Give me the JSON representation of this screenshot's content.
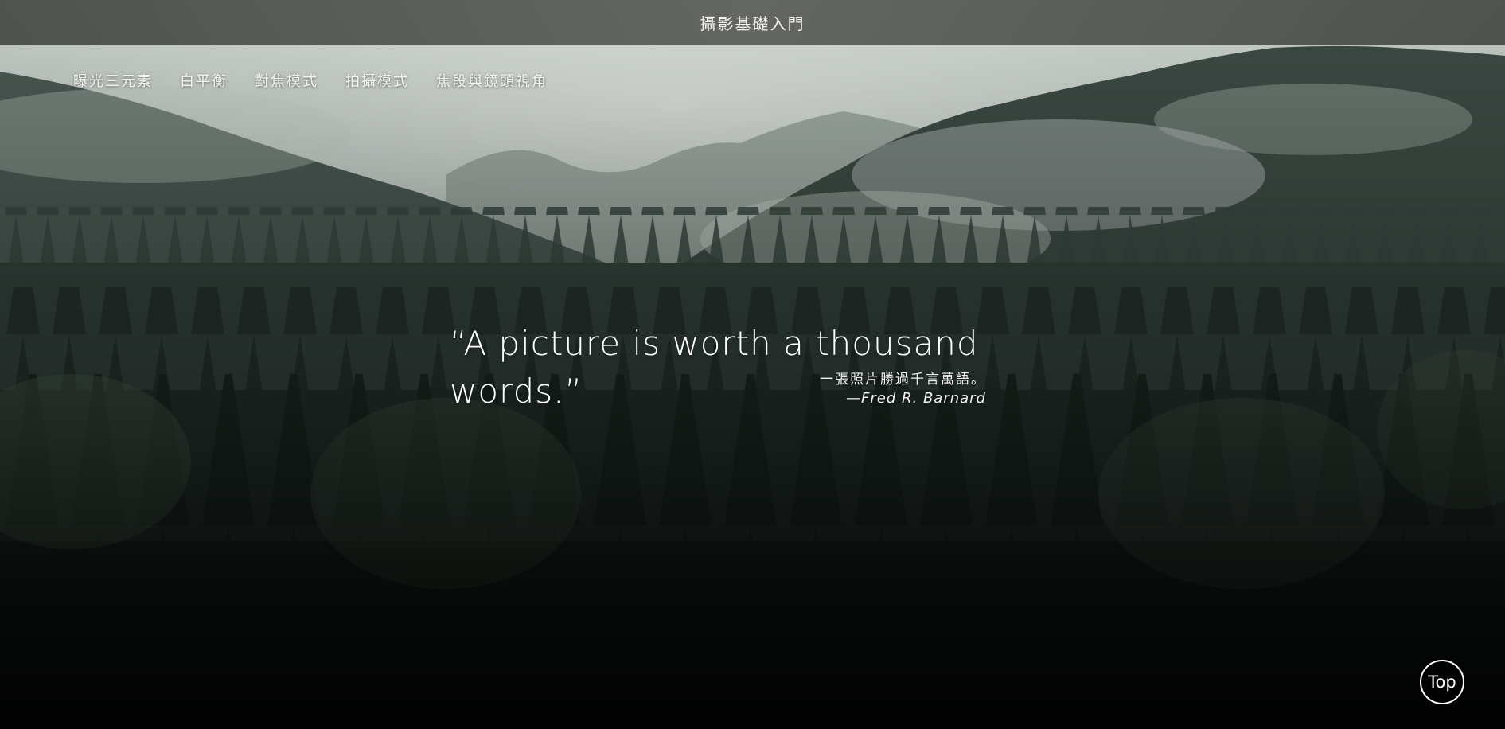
{
  "header": {
    "title": "攝影基礎入門"
  },
  "nav": {
    "items": [
      {
        "label": "曝光三元素"
      },
      {
        "label": "白平衡"
      },
      {
        "label": "對焦模式"
      },
      {
        "label": "拍攝模式"
      },
      {
        "label": "焦段與鏡頭視角"
      }
    ]
  },
  "hero": {
    "quote": "“A picture is worth a thousand words.”",
    "translation": "一張照片勝過千言萬語。",
    "author": "—Fred R. Barnard"
  },
  "scroll_top": {
    "label": "Top"
  },
  "colors": {
    "title_bar": "#585a55",
    "text": "#ffffff",
    "forest_dark": "#1c2622",
    "mist": "#b9c2bc"
  }
}
